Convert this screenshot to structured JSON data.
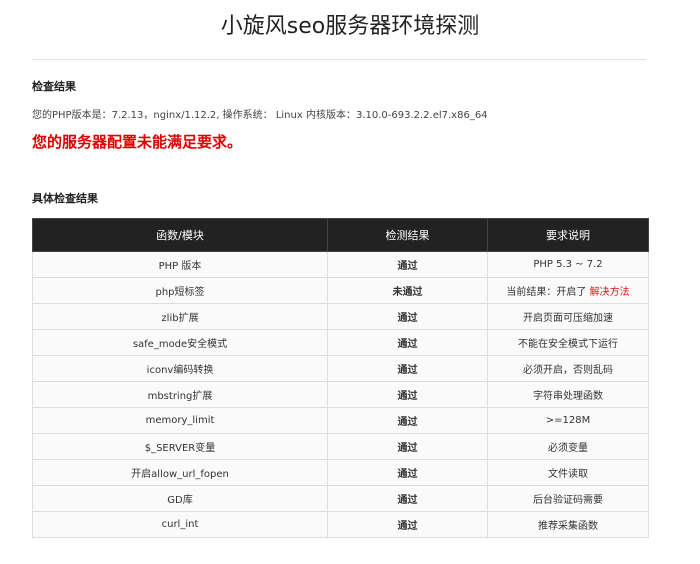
{
  "page": {
    "title": "小旋风seo服务器环境探测"
  },
  "check": {
    "heading": "检查结果",
    "version_info": "您的PHP版本是：7.2.13，nginx/1.12.2, 操作系统： Linux 内核版本：3.10.0-693.2.2.el7.x86_64",
    "alert": "您的服务器配置未能满足要求。"
  },
  "detail": {
    "heading": "具体检查结果",
    "columns": [
      "函数/模块",
      "检测结果",
      "要求说明"
    ],
    "rows": [
      {
        "module": "PHP 版本",
        "result": "通过",
        "status": "pass",
        "requirement": "PHP 5.3 ~ 7.2"
      },
      {
        "module": "php短标签",
        "result": "未通过",
        "status": "fail",
        "requirement": "当前结果：开启了",
        "link": "解决方法"
      },
      {
        "module": "zlib扩展",
        "result": "通过",
        "status": "pass",
        "requirement": "开启页面可压缩加速"
      },
      {
        "module": "safe_mode安全模式",
        "result": "通过",
        "status": "pass",
        "requirement": "不能在安全模式下运行"
      },
      {
        "module": "iconv编码转换",
        "result": "通过",
        "status": "pass",
        "requirement": "必须开启，否则乱码"
      },
      {
        "module": "mbstring扩展",
        "result": "通过",
        "status": "pass",
        "requirement": "字符串处理函数"
      },
      {
        "module": "memory_limit",
        "result": "通过",
        "status": "pass",
        "requirement": ">=128M"
      },
      {
        "module": "$_SERVER变量",
        "result": "通过",
        "status": "pass",
        "requirement": "必须变量"
      },
      {
        "module": "开启allow_url_fopen",
        "result": "通过",
        "status": "pass",
        "requirement": "文件读取"
      },
      {
        "module": "GD库",
        "result": "通过",
        "status": "pass",
        "requirement": "后台验证码需要"
      },
      {
        "module": "curl_int",
        "result": "通过",
        "status": "pass",
        "requirement": "推荐采集函数"
      }
    ]
  },
  "colors": {
    "pass": "#109010",
    "fail": "#e01818",
    "alert": "#e00000",
    "header_bg": "#222222"
  }
}
